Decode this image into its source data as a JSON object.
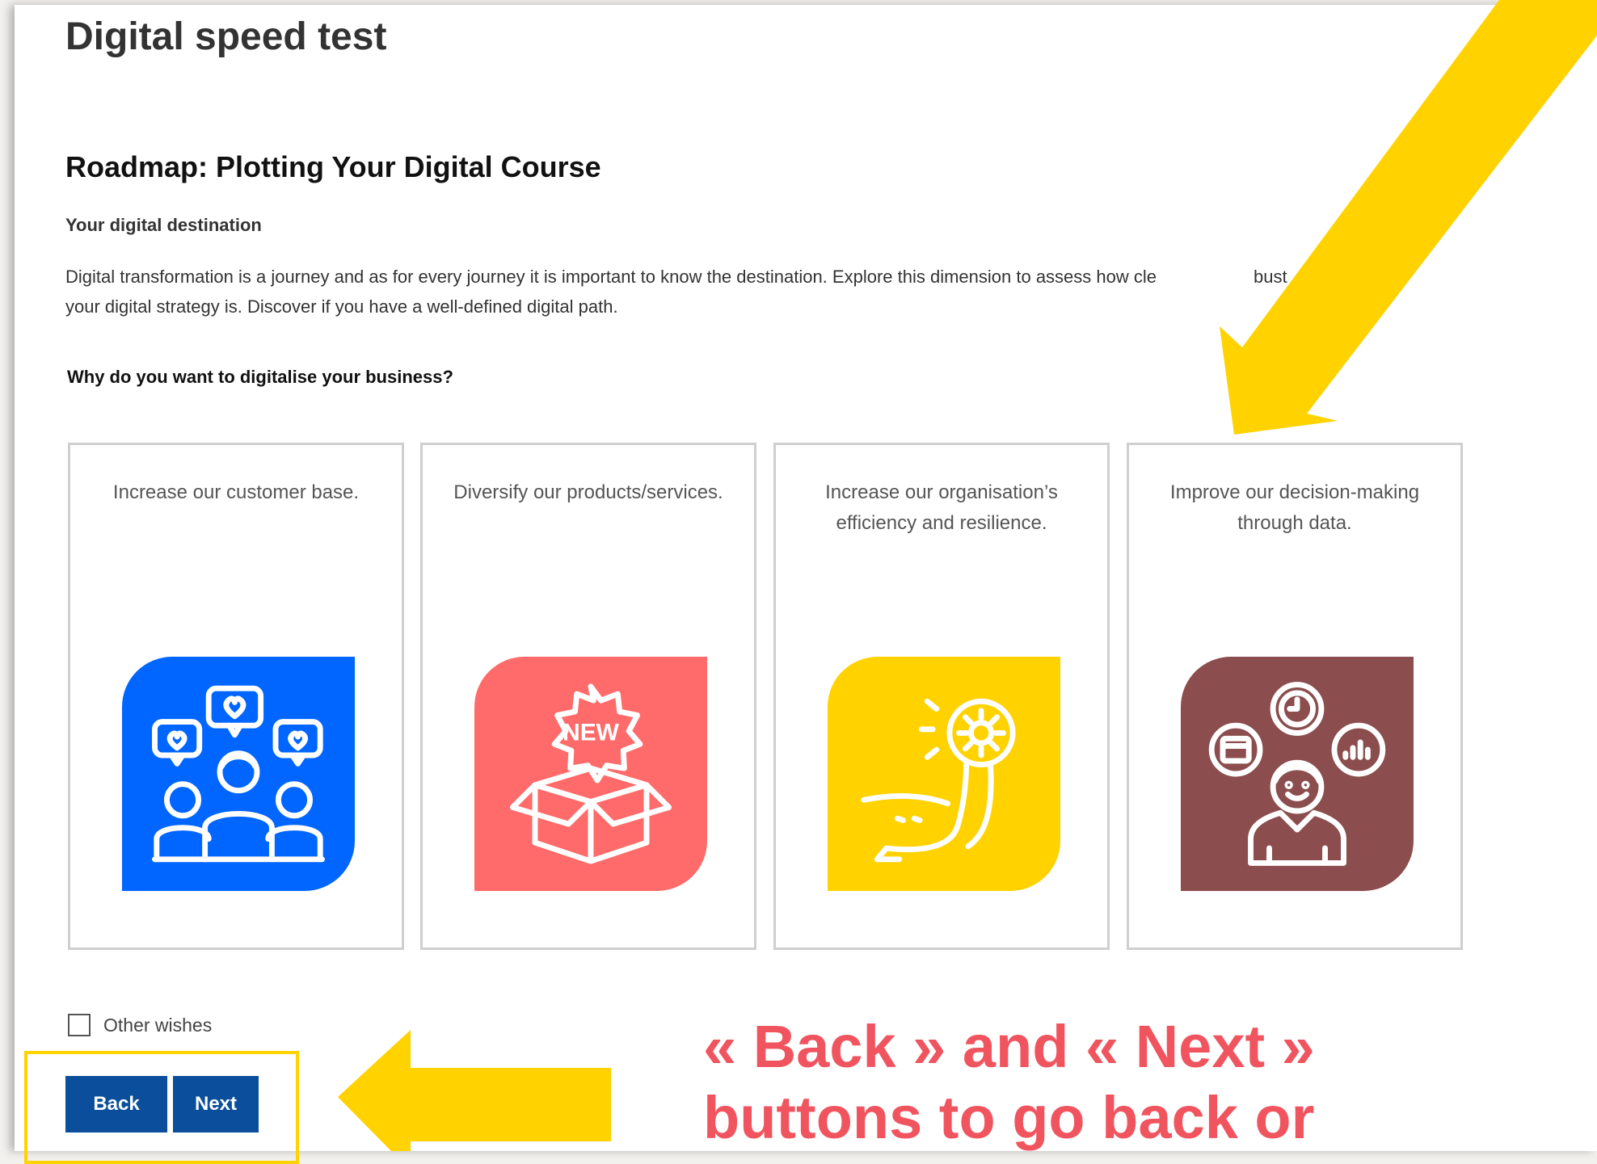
{
  "page": {
    "title": "Digital speed test",
    "section_title": "Roadmap: Plotting Your Digital Course",
    "subtitle": "Your digital destination",
    "description": "Digital transformation is a journey and as for every journey it is important to know the destination. Explore this dimension to assess how cle",
    "description_tail": "bust",
    "description_line2": "your digital strategy is. Discover if you have a well-defined digital path.",
    "question": "Why do you want to digitalise your business?"
  },
  "options": [
    {
      "text": "Increase our customer base.",
      "icon": "people-hearts-icon",
      "color": "#0066ff"
    },
    {
      "text": "Diversify our products/services.",
      "icon": "new-box-icon",
      "color": "#ff6b6b",
      "icon_text": "NEW"
    },
    {
      "text": "Increase our organisation’s efficiency and resilience.",
      "icon": "arm-gear-icon",
      "color": "#ffd200"
    },
    {
      "text": "Improve our decision-making through data.",
      "icon": "person-data-icon",
      "color": "#8b4d4d"
    }
  ],
  "other": {
    "label": "Other wishes",
    "checked": false
  },
  "buttons": {
    "back": "Back",
    "next": "Next"
  },
  "annotation": {
    "line1": "« Back » and « Next »",
    "line2": "buttons to go back or"
  },
  "colors": {
    "accent": "#ffd200",
    "button": "#0b4f9c",
    "annotation_text": "#f0555f"
  }
}
